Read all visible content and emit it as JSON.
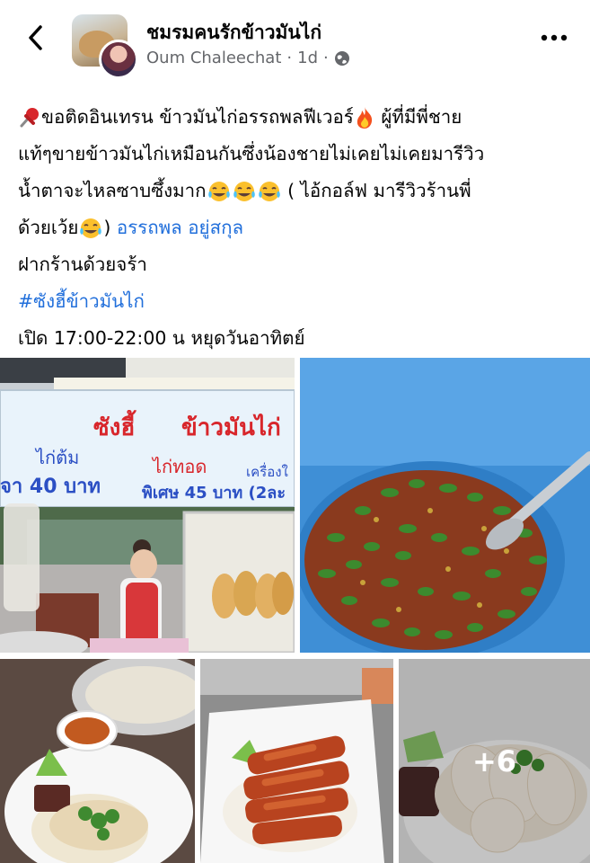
{
  "header": {
    "group_name": "ชมรมคนรักข้าวมันไก่",
    "author": "Oum Chaleechat",
    "separator": "·",
    "time": "1d",
    "separator2": "·"
  },
  "post": {
    "line1_text": "ขอติดอินเทรน ข้าวมันไก่อรรถพลฟีเวอร์",
    "line1_tail": " ผู้ที่มีพี่ชาย",
    "line2": "แท้ๆขายข้าวมันไก่เหมือนกันซึ่งน้องชายไม่เคยไม่เคยมารีวิว",
    "line3_text": "น้ำตาจะไหลซาบซึ้งมาก",
    "line3_tail": " ( ไอ้กอล์ฟ มารีวิวร้านพี่",
    "line4_text": "ด้วยเว้ย",
    "line4_tail": ")",
    "mention": "อรรถพล อยู่สกุล",
    "line5": "ฝากร้านด้วยจร้า",
    "hashtag": "#ซังฮี้ข้าวมันไก่",
    "line7": "เปิด 17:00-22:00 น หยุดวันอาทิตย์"
  },
  "photos": {
    "sign_title_left": "ซังฮี้",
    "sign_title_right": "ข้าวมันไก่",
    "sign_item1": "ไก่ต้ม",
    "sign_item2": "ไก่ทอด",
    "sign_item3": "เครื่องใ",
    "sign_price1": "จา 40 บาท",
    "sign_price2": "พิเศษ 45 บาท (2ละ",
    "more_count": "+6"
  },
  "colors": {
    "link": "#216fdb",
    "meta_text": "#65676b",
    "sign_red": "#d8262b",
    "sign_blue": "#2b4fc4"
  }
}
